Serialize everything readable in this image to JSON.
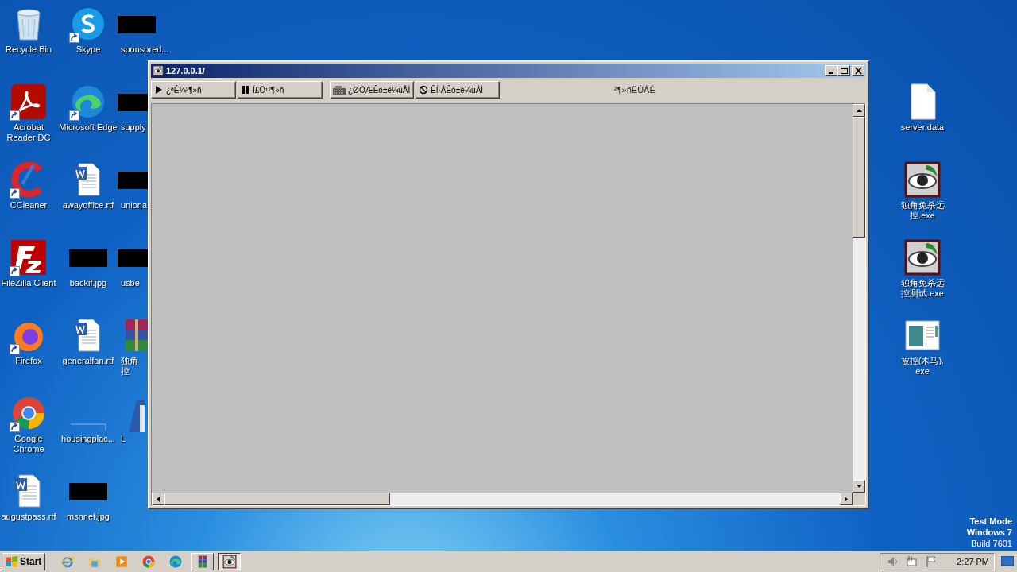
{
  "desktop": {
    "columns": [
      [
        {
          "label": "Recycle Bin",
          "kind": "recycle",
          "shortcut": false
        },
        {
          "label": "Acrobat Reader DC",
          "kind": "acrobat",
          "shortcut": true
        },
        {
          "label": "CCleaner",
          "kind": "ccleaner",
          "shortcut": true
        },
        {
          "label": "FileZilla Client",
          "kind": "filezilla",
          "shortcut": true
        },
        {
          "label": "Firefox",
          "kind": "firefox",
          "shortcut": true
        },
        {
          "label": "Google Chrome",
          "kind": "chrome",
          "shortcut": true
        },
        {
          "label": "augustpass.rtf",
          "kind": "word",
          "shortcut": false
        }
      ],
      [
        {
          "label": "Skype",
          "kind": "skype",
          "shortcut": true
        },
        {
          "label": "Microsoft Edge",
          "kind": "edge",
          "shortcut": true
        },
        {
          "label": "awayoffice.rtf",
          "kind": "word",
          "shortcut": false
        },
        {
          "label": "backif.jpg",
          "kind": "redacted",
          "shortcut": false
        },
        {
          "label": "generalfan.rtf",
          "kind": "word",
          "shortcut": false
        },
        {
          "label": "housingplac...",
          "kind": "blank",
          "shortcut": false
        },
        {
          "label": "msnnet.jpg",
          "kind": "redacted",
          "shortcut": false
        }
      ],
      [
        {
          "label": "sponsored...",
          "kind": "redacted",
          "shortcut": false
        },
        {
          "label": "supply",
          "kind": "redacted",
          "shortcut": false
        },
        {
          "label": "uniona",
          "kind": "redacted",
          "shortcut": false
        },
        {
          "label": "usbe",
          "kind": "redacted",
          "shortcut": false
        },
        {
          "label": "独角控",
          "kind": "winrar",
          "shortcut": false
        },
        {
          "label": "L",
          "kind": "letter",
          "shortcut": false
        }
      ]
    ],
    "right_column": [
      {
        "label": "server.data",
        "kind": "file"
      },
      {
        "label": "独角免杀远控.exe",
        "kind": "eye"
      },
      {
        "label": "独角免杀远控测试.exe",
        "kind": "eye"
      },
      {
        "label": "被控(木马).exe",
        "kind": "appwin"
      }
    ]
  },
  "window": {
    "title": "127.0.0.1/",
    "toolbar": [
      {
        "label": "¿ªÊ¼²¶»ñ",
        "kind": "play"
      },
      {
        "label": "Í£Ö¹²¶»ñ",
        "kind": "pause"
      },
      {
        "label": "¿ØÖÆÊó±ê¼üÅÌ",
        "kind": "keyboard"
      },
      {
        "label": "ÊÍ·ÅÊó±ê¼üÅÌ",
        "kind": "block"
      }
    ],
    "rate_label": "²¶»ñËÙÂÊ"
  },
  "notice": [
    "Test Mode",
    "Windows 7",
    "Build 7601"
  ],
  "taskbar": {
    "start": "Start",
    "items": [
      {
        "kind": "ie",
        "running": false
      },
      {
        "kind": "explorer",
        "running": false
      },
      {
        "kind": "media",
        "running": false
      },
      {
        "kind": "chrome",
        "running": false
      },
      {
        "kind": "edge",
        "running": false
      },
      {
        "kind": "winrar",
        "running": true,
        "active": false
      },
      {
        "kind": "eye",
        "running": true,
        "active": true
      }
    ],
    "clock": "2:27 PM"
  }
}
